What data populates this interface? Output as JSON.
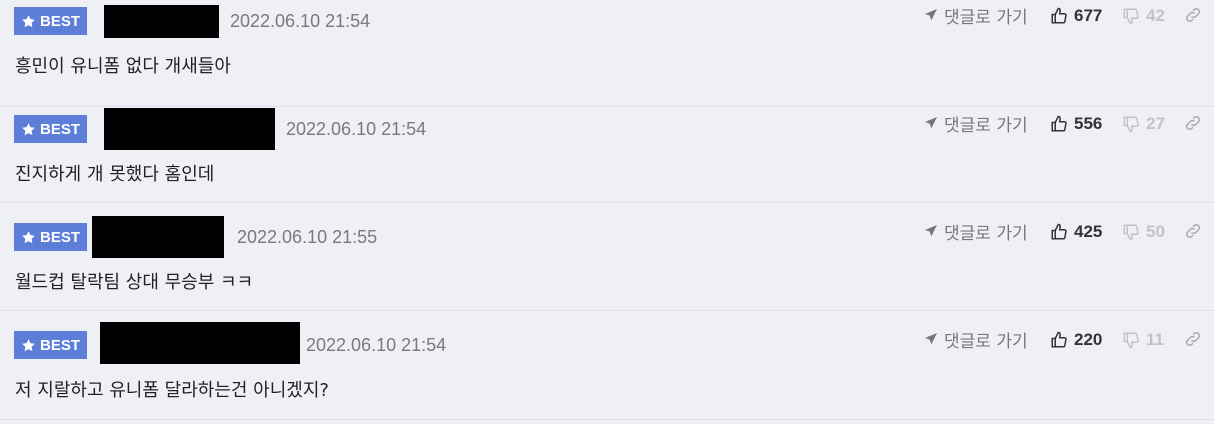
{
  "colors": {
    "badge": "#5c7ed9",
    "background": "#eef0f6",
    "date": "#7a7a7a"
  },
  "comments": [
    {
      "badge": "BEST",
      "date": "2022.06.10 21:54",
      "text": "흥민이 유니폼 없다 개새들아",
      "reply": "댓글로 가기",
      "upvotes": "677",
      "downvotes": "42"
    },
    {
      "badge": "BEST",
      "date": "2022.06.10 21:54",
      "text": "진지하게 개 못했다 홈인데",
      "reply": "댓글로 가기",
      "upvotes": "556",
      "downvotes": "27"
    },
    {
      "badge": "BEST",
      "date": "2022.06.10 21:55",
      "text": "월드컵 탈락팀 상대 무승부 ㅋㅋ",
      "reply": "댓글로 가기",
      "upvotes": "425",
      "downvotes": "50"
    },
    {
      "badge": "BEST",
      "date": "2022.06.10 21:54",
      "text": "저 지랄하고 유니폼 달라하는건 아니겠지?",
      "reply": "댓글로 가기",
      "upvotes": "220",
      "downvotes": "11"
    }
  ]
}
